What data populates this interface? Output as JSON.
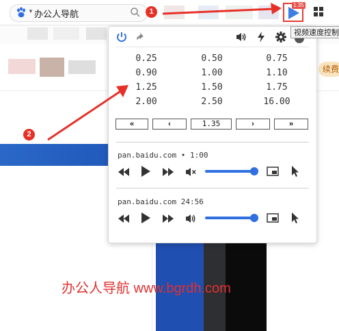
{
  "toolbar": {
    "search_text": "办公人导航",
    "extension_badge": "1.35",
    "tooltip": "视频速度控制"
  },
  "background": {
    "pill_label": "续费"
  },
  "popup": {
    "speeds": [
      [
        "0.25",
        "0.50",
        "0.75"
      ],
      [
        "0.90",
        "1.00",
        "1.10"
      ],
      [
        "1.25",
        "1.50",
        "1.75"
      ],
      [
        "2.00",
        "2.50",
        "16.00"
      ]
    ],
    "nav": {
      "fast_back": "«",
      "back": "‹",
      "current": "1.35",
      "forward": "›",
      "fast_forward": "»"
    },
    "media": [
      {
        "title": "pan.baidu.com • 1:00",
        "muted": true,
        "volume": 1.0
      },
      {
        "title": "pan.baidu.com 24:56",
        "muted": false,
        "volume": 1.0
      }
    ]
  },
  "annotations": {
    "step1": "1",
    "step2": "2",
    "watermark": "办公人导航 www.bgrdh.com"
  },
  "colors": {
    "accent": "#2f6fe0",
    "annotation": "#e63027"
  }
}
